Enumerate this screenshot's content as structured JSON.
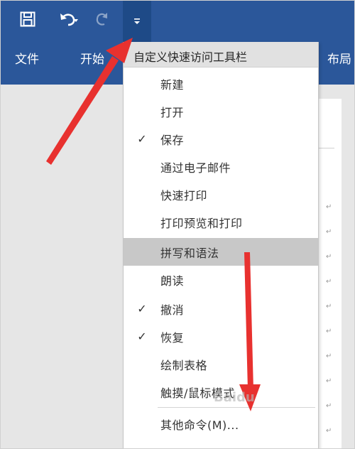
{
  "quick_access": {
    "save_icon": "save-icon",
    "undo_icon": "undo-icon",
    "redo_icon": "redo-icon",
    "customize_icon": "customize-dropdown-icon"
  },
  "ribbon": {
    "tabs": [
      "文件",
      "开始",
      "布局"
    ]
  },
  "menu": {
    "header": "自定义快速访问工具栏",
    "items": [
      {
        "label": "新建",
        "checked": false
      },
      {
        "label": "打开",
        "checked": false
      },
      {
        "label": "保存",
        "checked": true
      },
      {
        "label": "通过电子邮件",
        "checked": false
      },
      {
        "label": "快速打印",
        "checked": false
      },
      {
        "label": "打印预览和打印",
        "checked": false
      },
      {
        "label": "拼写和语法",
        "checked": false
      },
      {
        "label": "朗读",
        "checked": false
      },
      {
        "label": "撤消",
        "checked": true
      },
      {
        "label": "恢复",
        "checked": true
      },
      {
        "label": "绘制表格",
        "checked": false
      },
      {
        "label": "触摸/鼠标模式",
        "checked": false
      }
    ],
    "more_commands": "其他命令(M)...",
    "check_mark": "✓"
  },
  "colors": {
    "titlebar": "#2b579a",
    "highlight": "#c8c8c8",
    "arrow": "#e8312f"
  },
  "watermark": "Baidu"
}
